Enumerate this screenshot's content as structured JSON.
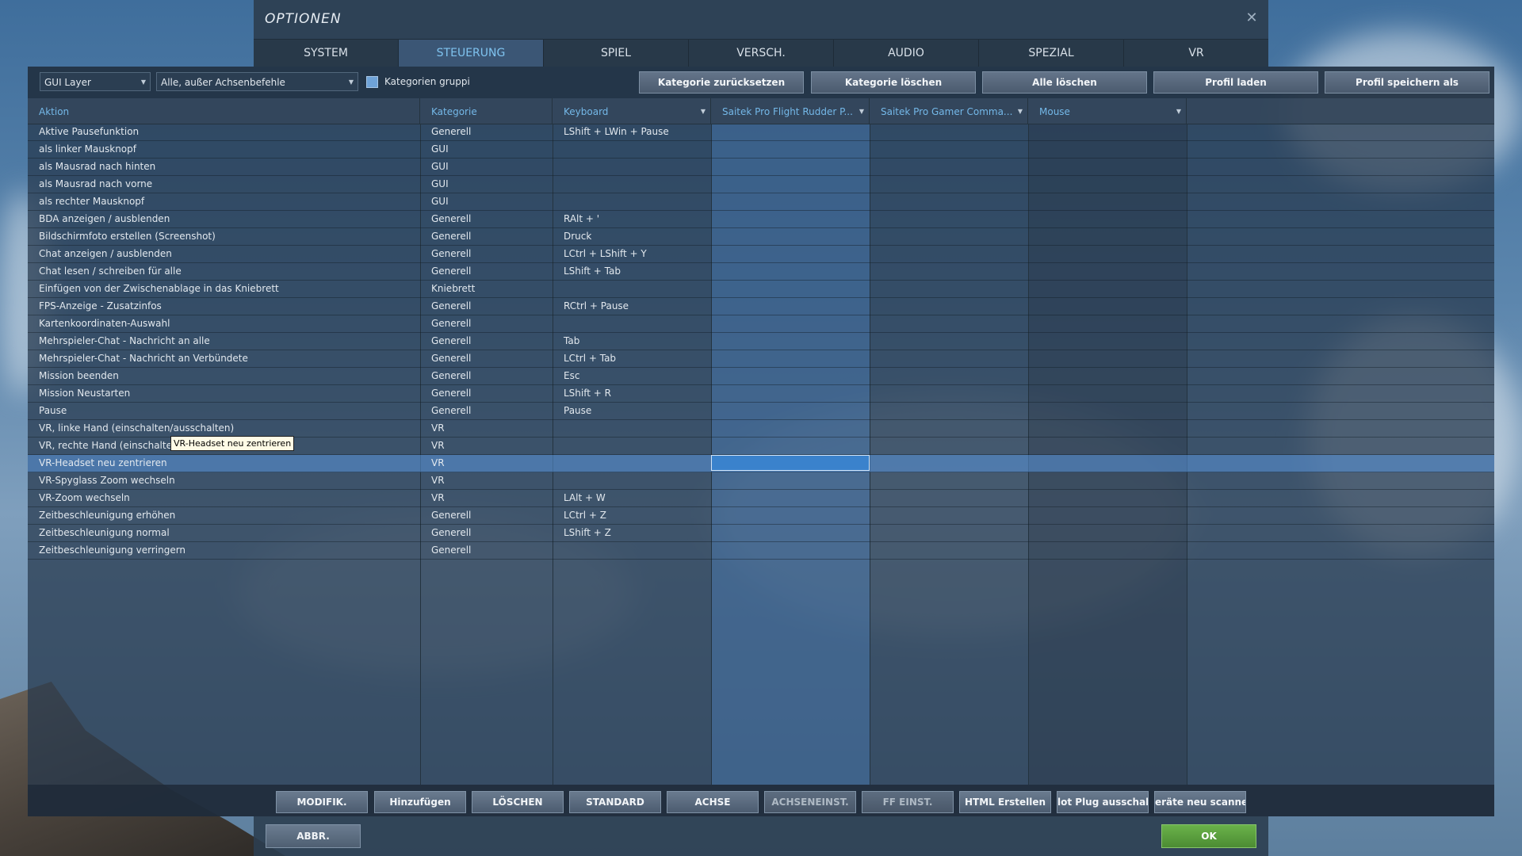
{
  "window": {
    "title": "OPTIONEN",
    "close_glyph": "✕"
  },
  "tabs": [
    {
      "label": "SYSTEM",
      "active": false
    },
    {
      "label": "STEUERUNG",
      "active": true
    },
    {
      "label": "SPIEL",
      "active": false
    },
    {
      "label": "VERSCH.",
      "active": false
    },
    {
      "label": "AUDIO",
      "active": false
    },
    {
      "label": "SPEZIAL",
      "active": false
    },
    {
      "label": "VR",
      "active": false
    }
  ],
  "toolbar": {
    "aircraft_select": "GUI Layer",
    "filter_select": "Alle, außer Achsenbefehle",
    "group_checkbox_label": "Kategorien gruppi",
    "group_checkbox_checked": true,
    "buttons": [
      "Kategorie zurücksetzen",
      "Kategorie löschen",
      "Alle löschen",
      "Profil laden",
      "Profil speichern als"
    ]
  },
  "columns": {
    "action": "Aktion",
    "category": "Kategorie",
    "keyboard": "Keyboard",
    "device1": "Saitek Pro Flight Rudder P...",
    "device2": "Saitek Pro Gamer Comma...",
    "mouse": "Mouse"
  },
  "rows": [
    {
      "action": "Aktive Pausefunktion",
      "category": "Generell",
      "keyboard": "LShift + LWin + Pause"
    },
    {
      "action": "als linker Mausknopf",
      "category": "GUI",
      "keyboard": ""
    },
    {
      "action": "als Mausrad nach hinten",
      "category": "GUI",
      "keyboard": ""
    },
    {
      "action": "als Mausrad nach vorne",
      "category": "GUI",
      "keyboard": ""
    },
    {
      "action": "als rechter Mausknopf",
      "category": "GUI",
      "keyboard": ""
    },
    {
      "action": "BDA anzeigen / ausblenden",
      "category": "Generell",
      "keyboard": "RAlt + '"
    },
    {
      "action": "Bildschirmfoto erstellen (Screenshot)",
      "category": "Generell",
      "keyboard": "Druck"
    },
    {
      "action": "Chat anzeigen / ausblenden",
      "category": "Generell",
      "keyboard": "LCtrl + LShift + Y"
    },
    {
      "action": "Chat lesen / schreiben für alle",
      "category": "Generell",
      "keyboard": "LShift + Tab"
    },
    {
      "action": "Einfügen von der Zwischenablage in das Kniebrett",
      "category": "Kniebrett",
      "keyboard": ""
    },
    {
      "action": "FPS-Anzeige - Zusatzinfos",
      "category": "Generell",
      "keyboard": "RCtrl + Pause"
    },
    {
      "action": "Kartenkoordinaten-Auswahl",
      "category": "Generell",
      "keyboard": ""
    },
    {
      "action": "Mehrspieler-Chat - Nachricht an alle",
      "category": "Generell",
      "keyboard": "Tab"
    },
    {
      "action": "Mehrspieler-Chat - Nachricht an Verbündete",
      "category": "Generell",
      "keyboard": "LCtrl + Tab"
    },
    {
      "action": "Mission beenden",
      "category": "Generell",
      "keyboard": "Esc"
    },
    {
      "action": "Mission Neustarten",
      "category": "Generell",
      "keyboard": "LShift + R"
    },
    {
      "action": "Pause",
      "category": "Generell",
      "keyboard": "Pause"
    },
    {
      "action": "VR, linke Hand (einschalten/ausschalten)",
      "category": "VR",
      "keyboard": ""
    },
    {
      "action": "VR, rechte Hand (einschalten/ausschalten)",
      "category": "VR",
      "keyboard": ""
    },
    {
      "action": "VR-Headset neu zentrieren",
      "category": "VR",
      "keyboard": "",
      "selected": true
    },
    {
      "action": "VR-Spyglass Zoom wechseln",
      "category": "VR",
      "keyboard": ""
    },
    {
      "action": "VR-Zoom wechseln",
      "category": "VR",
      "keyboard": "LAlt + W"
    },
    {
      "action": "Zeitbeschleunigung erhöhen",
      "category": "Generell",
      "keyboard": "LCtrl + Z"
    },
    {
      "action": "Zeitbeschleunigung normal",
      "category": "Generell",
      "keyboard": "LShift + Z"
    },
    {
      "action": "Zeitbeschleunigung verringern",
      "category": "Generell",
      "keyboard": ""
    }
  ],
  "tooltip": "VR-Headset neu zentrieren",
  "bottom_buttons": [
    {
      "label": "MODIFIK.",
      "disabled": false
    },
    {
      "label": "Hinzufügen",
      "disabled": false
    },
    {
      "label": "LÖSCHEN",
      "disabled": false
    },
    {
      "label": "STANDARD",
      "disabled": false
    },
    {
      "label": "ACHSE",
      "disabled": false
    },
    {
      "label": "ACHSENEINST.",
      "disabled": true
    },
    {
      "label": "FF EINST.",
      "disabled": true
    },
    {
      "label": "HTML Erstellen",
      "disabled": false
    },
    {
      "label": "lot Plug ausschalte",
      "disabled": false
    },
    {
      "label": "eräte neu scanne",
      "disabled": false
    }
  ],
  "footer": {
    "cancel": "ABBR.",
    "ok": "OK"
  },
  "colors": {
    "accent": "#74b8e8",
    "ok_green": "#5aa23f",
    "selection": "#3a82cc"
  }
}
